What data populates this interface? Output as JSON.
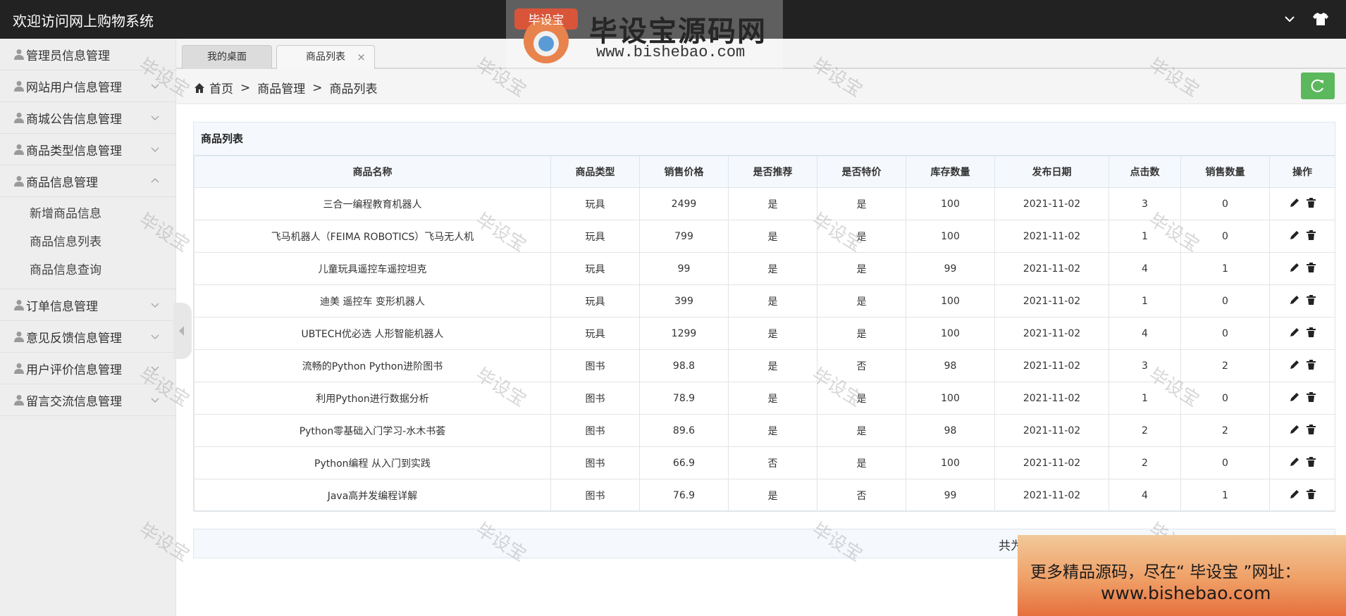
{
  "app": {
    "title": "欢迎访问网上购物系统"
  },
  "sidebar": {
    "items": [
      {
        "label": "管理员信息管理",
        "expandable": false
      },
      {
        "label": "网站用户信息管理",
        "expandable": true
      },
      {
        "label": "商城公告信息管理",
        "expandable": true
      },
      {
        "label": "商品类型信息管理",
        "expandable": true
      },
      {
        "label": "商品信息管理",
        "expandable": true,
        "expanded": true
      },
      {
        "label": "订单信息管理",
        "expandable": true
      },
      {
        "label": "意见反馈信息管理",
        "expandable": true
      },
      {
        "label": "用户评价信息管理",
        "expandable": true
      },
      {
        "label": "留言交流信息管理",
        "expandable": true
      }
    ],
    "submenu": [
      "新增商品信息",
      "商品信息列表",
      "商品信息查询"
    ]
  },
  "tabs": [
    {
      "label": "我的桌面"
    },
    {
      "label": "商品列表",
      "close": "×"
    }
  ],
  "breadcrumb": {
    "home": "首页",
    "sep": ">",
    "level1": "商品管理",
    "level2": "商品列表"
  },
  "panel": {
    "title": "商品列表",
    "columns": [
      "商品名称",
      "商品类型",
      "销售价格",
      "是否推荐",
      "是否特价",
      "库存数量",
      "发布日期",
      "点击数",
      "销售数量",
      "操作"
    ],
    "rows": [
      [
        "三合一编程教育机器人",
        "玩具",
        "2499",
        "是",
        "是",
        "100",
        "2021-11-02",
        "3",
        "0"
      ],
      [
        "飞马机器人（FEIMA ROBOTICS）飞马无人机",
        "玩具",
        "799",
        "是",
        "是",
        "100",
        "2021-11-02",
        "1",
        "0"
      ],
      [
        "儿童玩具遥控车遥控坦克",
        "玩具",
        "99",
        "是",
        "是",
        "99",
        "2021-11-02",
        "4",
        "1"
      ],
      [
        "迪美 遥控车 变形机器人",
        "玩具",
        "399",
        "是",
        "是",
        "100",
        "2021-11-02",
        "1",
        "0"
      ],
      [
        "UBTECH优必选 人形智能机器人",
        "玩具",
        "1299",
        "是",
        "是",
        "100",
        "2021-11-02",
        "4",
        "0"
      ],
      [
        "流畅的Python Python进阶图书",
        "图书",
        "98.8",
        "是",
        "否",
        "98",
        "2021-11-02",
        "3",
        "2"
      ],
      [
        "利用Python进行数据分析",
        "图书",
        "78.9",
        "是",
        "是",
        "100",
        "2021-11-02",
        "1",
        "0"
      ],
      [
        "Python零基础入门学习-水木书荟",
        "图书",
        "89.6",
        "是",
        "是",
        "98",
        "2021-11-02",
        "2",
        "2"
      ],
      [
        "Python编程 从入门到实践",
        "图书",
        "66.9",
        "否",
        "是",
        "100",
        "2021-11-02",
        "2",
        "0"
      ],
      [
        "Java高并发编程详解",
        "图书",
        "76.9",
        "是",
        "否",
        "99",
        "2021-11-02",
        "4",
        "1"
      ]
    ],
    "footer_text": "共为"
  },
  "overlay": {
    "logo_badge": "毕设宝",
    "logo_brand": "毕设宝源码网",
    "logo_url": "www.bishebao.com",
    "watermark": "毕设宝",
    "promo_line1": "更多精品源码，尽在“ 毕设宝 ”网址：",
    "promo_line2": "www.bishebao.com"
  },
  "colors": {
    "topbar": "#222222",
    "sidebar": "#eeeeee",
    "refresh_button": "#5cb85c",
    "table_header": "#f5f9fd"
  },
  "icons": {
    "topbar": [
      "chevron-down-icon",
      "tshirt-icon"
    ],
    "sidebar": [
      "user-icon",
      "chevron-down-icon",
      "chevron-up-icon"
    ],
    "breadcrumb": "home-icon",
    "refresh": "refresh-icon",
    "row_ops": [
      "edit-icon",
      "trash-icon"
    ]
  }
}
